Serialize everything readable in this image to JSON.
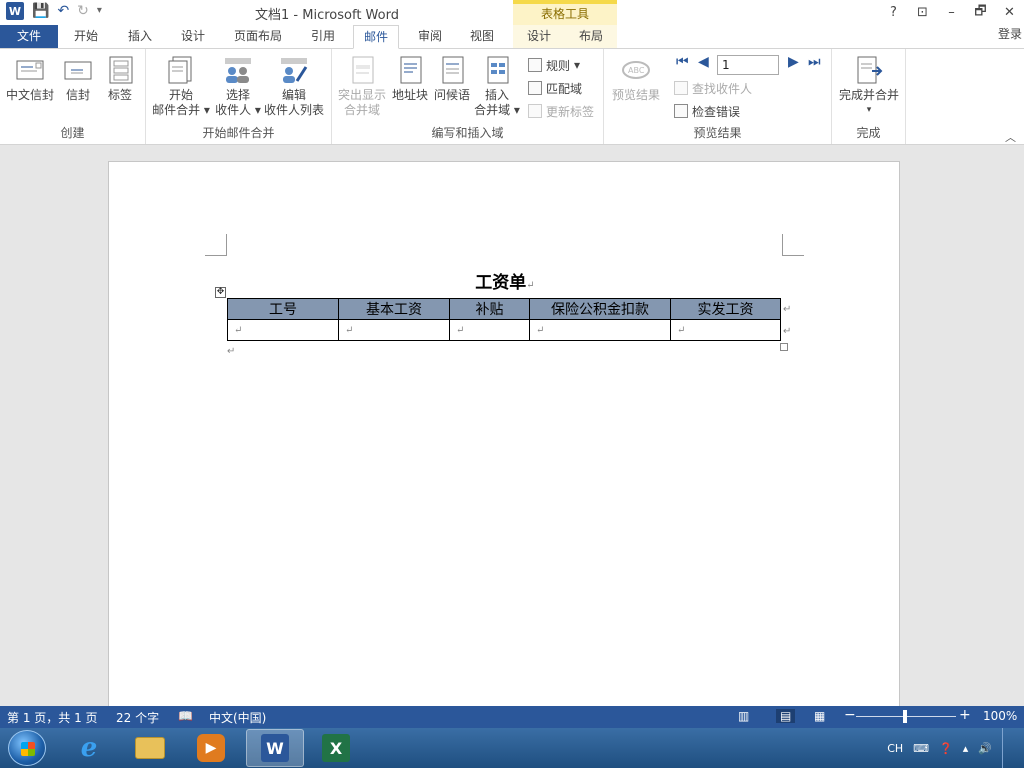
{
  "window": {
    "title": "文档1 - Microsoft Word",
    "context_tab_header": "表格工具",
    "help": "?",
    "restore_ribbon": "⊡",
    "minimize": "–",
    "maximize": "🗗",
    "close": "✕"
  },
  "qat": {
    "logo": "W",
    "save": "💾",
    "undo": "↶",
    "redo": "↻",
    "more": "▾"
  },
  "tabs": {
    "file": "文件",
    "home": "开始",
    "insert": "插入",
    "design": "设计",
    "layout": "页面布局",
    "references": "引用",
    "mailings": "邮件",
    "review": "审阅",
    "view": "视图",
    "table_design": "设计",
    "table_layout": "布局",
    "login": "登录"
  },
  "ribbon": {
    "create": {
      "label": "创建",
      "envelopes_cn": "中文信封",
      "envelopes": "信封",
      "labels": "标签"
    },
    "start_merge": {
      "label": "开始邮件合并",
      "start_line1": "开始",
      "start_line2": "邮件合并",
      "select_line1": "选择",
      "select_line2": "收件人",
      "edit_line1": "编辑",
      "edit_line2": "收件人列表"
    },
    "write_insert": {
      "label": "编写和插入域",
      "highlight_line1": "突出显示",
      "highlight_line2": "合并域",
      "address_block": "地址块",
      "greeting": "问候语",
      "insert_line1": "插入",
      "insert_line2": "合并域",
      "rules": "规则",
      "match_fields": "匹配域",
      "update_labels": "更新标签"
    },
    "preview": {
      "label": "预览结果",
      "preview_results": "预览结果",
      "record_value": "1",
      "find_recipient": "查找收件人",
      "check_errors": "检查错误"
    },
    "finish": {
      "label": "完成",
      "finish_merge": "完成并合并"
    }
  },
  "document": {
    "title": "工资单",
    "para_mark": "↵",
    "table_move": "✥",
    "table": {
      "headers": [
        "工号",
        "基本工资",
        "补贴",
        "保险公积金扣款",
        "实发工资"
      ],
      "rows": [
        [
          "↵",
          "↵",
          "↵",
          "↵",
          "↵"
        ]
      ]
    }
  },
  "status": {
    "page": "第 1 页，共 1 页",
    "words": "22 个字",
    "language": "中文(中国)",
    "zoom_minus": "−",
    "zoom_plus": "+",
    "zoom": "100%",
    "zoom_level": 1.0
  },
  "taskbar": {
    "tray_lang": "CH",
    "apps": [
      "Internet Explorer",
      "Windows Explorer",
      "Media Player",
      "Word",
      "Excel"
    ]
  },
  "colors": {
    "word_blue": "#2b579a",
    "table_header": "#8497b0",
    "context_yellow": "#f5d94a"
  }
}
